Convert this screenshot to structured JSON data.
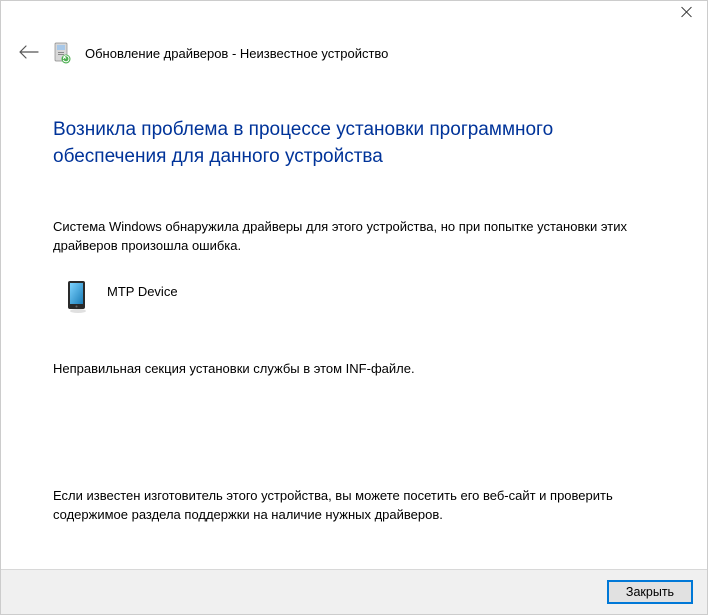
{
  "header": {
    "title": "Обновление драйверов - Неизвестное устройство"
  },
  "content": {
    "heading": "Возникла проблема в процессе установки программного обеспечения для данного устройства",
    "description": "Система Windows обнаружила драйверы для этого устройства, но при попытке установки этих драйверов произошла ошибка.",
    "device_name": "MTP Device",
    "error_text": "Неправильная секция установки службы в этом INF-файле.",
    "hint_text": "Если известен изготовитель этого устройства, вы можете посетить его веб-сайт и проверить содержимое раздела поддержки на наличие нужных драйверов."
  },
  "footer": {
    "close_label": "Закрыть"
  }
}
